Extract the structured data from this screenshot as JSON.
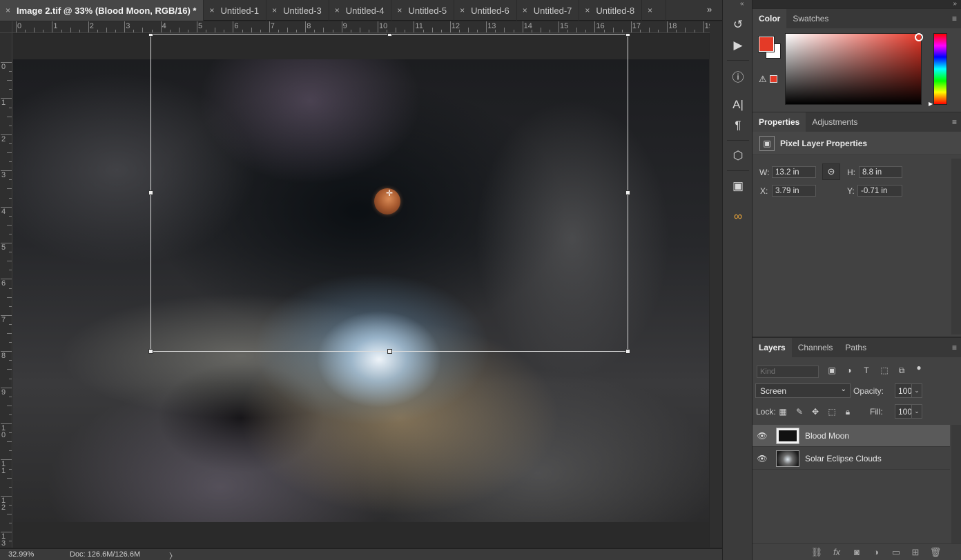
{
  "document_tabs": [
    {
      "label": "Image 2.tif @ 33% (Blood Moon, RGB/16) *",
      "active": true
    },
    {
      "label": "Untitled-1",
      "active": false
    },
    {
      "label": "Untitled-3",
      "active": false
    },
    {
      "label": "Untitled-4",
      "active": false
    },
    {
      "label": "Untitled-5",
      "active": false
    },
    {
      "label": "Untitled-6",
      "active": false
    },
    {
      "label": "Untitled-7",
      "active": false
    },
    {
      "label": "Untitled-8",
      "active": false
    },
    {
      "label": "",
      "active": false
    }
  ],
  "tab_close_glyph": "×",
  "tab_overflow_glyph": "»",
  "ruler": {
    "horizontal": [
      "0",
      "1",
      "2",
      "3",
      "4",
      "5",
      "6",
      "7",
      "8",
      "9",
      "10",
      "11",
      "12",
      "13",
      "14",
      "15",
      "16",
      "17",
      "18",
      "19"
    ],
    "vertical": [
      "0",
      "1",
      "2",
      "3",
      "4",
      "5",
      "6",
      "7",
      "8",
      "9",
      "10",
      "11",
      "12",
      "13"
    ]
  },
  "status": {
    "zoom": "32.99%",
    "doc_size": "Doc: 126.6M/126.6M",
    "arrow": "〉"
  },
  "toolstrip": {
    "icons": [
      "history-icon",
      "play-actions-icon",
      "info-icon",
      "character-icon",
      "paragraph-icon",
      "3d-icon",
      "image-icon",
      "creative-cloud-icon"
    ],
    "glyphs": [
      "↺",
      "▶",
      "ⓘ",
      "A|",
      "¶",
      "⬡",
      "▣",
      "∞"
    ]
  },
  "color_panel": {
    "tabs": [
      "Color",
      "Swatches"
    ],
    "foreground": "#e43a27",
    "background": "#ffffff",
    "warning_glyph": "⚠"
  },
  "properties_panel": {
    "tabs": [
      "Properties",
      "Adjustments"
    ],
    "title": "Pixel Layer Properties",
    "w_label": "W:",
    "w_value": "13.2 in",
    "h_label": "H:",
    "h_value": "8.8 in",
    "x_label": "X:",
    "x_value": "3.79 in",
    "y_label": "Y:",
    "y_value": "-0.71 in"
  },
  "layers_panel": {
    "tabs": [
      "Layers",
      "Channels",
      "Paths"
    ],
    "filter_placeholder": "Kind",
    "blend_mode": "Screen",
    "opacity_label": "Opacity:",
    "opacity_value": "100%",
    "lock_label": "Lock:",
    "fill_label": "Fill:",
    "fill_value": "100%",
    "layers": [
      {
        "name": "Blood Moon",
        "selected": true
      },
      {
        "name": "Solar Eclipse Clouds",
        "selected": false
      }
    ]
  },
  "panel_menu_glyph": "≡"
}
